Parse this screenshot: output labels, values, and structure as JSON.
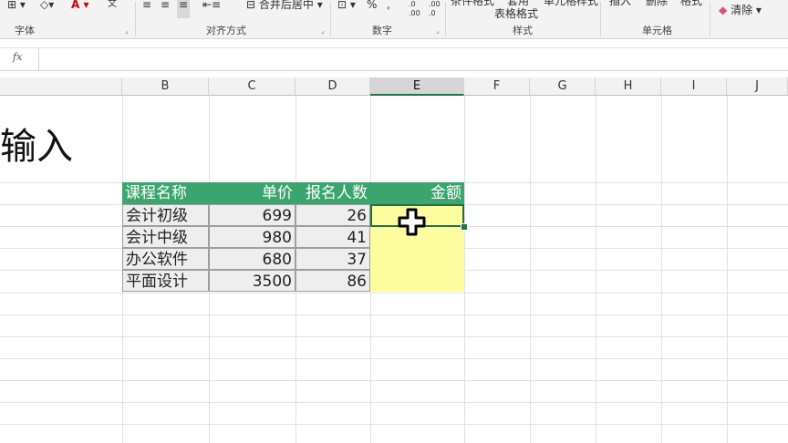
{
  "ribbon": {
    "top_items": {
      "wrap_text_label": "文",
      "merge_center_label": "合并后居中",
      "percent_symbol": "%",
      "comma_symbol": ",",
      "conditional_format_label": "条件格式",
      "table_format_label_top": "套用",
      "table_format_label_bottom": "表格格式",
      "cell_styles_label": "单元格样式",
      "insert_label": "插入",
      "delete_label": "删除",
      "format_label": "格式",
      "clear_label": "清除"
    },
    "groups": {
      "font": "字体",
      "alignment": "对齐方式",
      "number": "数字",
      "styles": "样式",
      "cells": "单元格"
    }
  },
  "formula_bar": {
    "fx_label": "fx",
    "value": ""
  },
  "columns": [
    "B",
    "C",
    "D",
    "E",
    "F",
    "G",
    "H",
    "I",
    "J"
  ],
  "sheet": {
    "big_title": "输入",
    "table": {
      "headers": [
        "课程名称",
        "单价",
        "报名人数",
        "金额"
      ],
      "rows": [
        [
          "会计初级",
          "699",
          "26",
          ""
        ],
        [
          "会计中级",
          "980",
          "41",
          ""
        ],
        [
          "办公软件",
          "680",
          "37",
          ""
        ],
        [
          "平面设计",
          "3500",
          "86",
          ""
        ]
      ]
    },
    "selected_column": "E"
  },
  "colors": {
    "header_green": "#3aa56e",
    "selection_green": "#217346",
    "amount_yellow": "#fdfda0"
  }
}
